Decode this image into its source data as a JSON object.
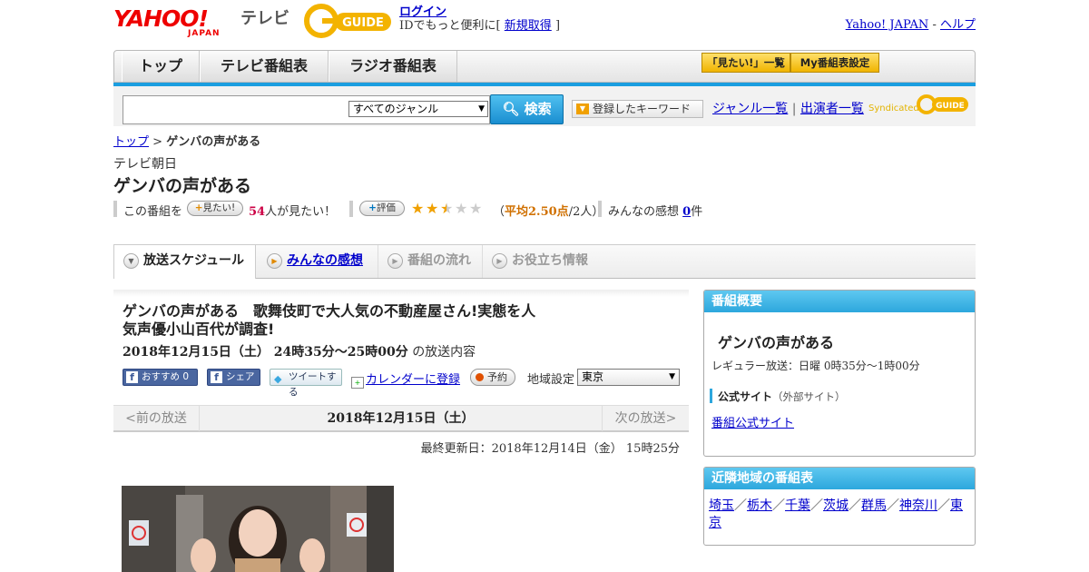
{
  "header": {
    "yahoo_logo": "YAHOO!",
    "yahoo_sub": "JAPAN",
    "tv_label": "テレビ",
    "gguide_logo": "G GUIDE",
    "login_label": "ログイン",
    "id_prefix": "IDでもっと便利に[",
    "signup_label": "新規取得",
    "id_suffix": "]",
    "yahoo_japan_link": "Yahoo! JAPAN",
    "separator": "-",
    "help_link": "ヘルプ"
  },
  "nav": {
    "top": "トップ",
    "tv_guide": "テレビ番組表",
    "radio_guide": "ラジオ番組表",
    "mitai_list": "「見たい!」一覧",
    "my_guide": "My番組表設定"
  },
  "search": {
    "placeholder": "",
    "genre_selected": "すべてのジャンル",
    "search_button": "検索",
    "keyword_button": "登録したキーワード",
    "genre_list_link": "ジャンル一覧",
    "link_separator": "|",
    "performers_link": "出演者一覧",
    "syndicated_label": "Syndicated"
  },
  "breadcrumb": {
    "top": "トップ",
    "sep": ">",
    "current": "ゲンバの声がある"
  },
  "program": {
    "station": "テレビ朝日",
    "title": "ゲンバの声がある",
    "mitai_prefix": "この番組を",
    "mitai_button": "見たい!",
    "mitai_count": "54",
    "mitai_suffix": "人が見たい！",
    "rating_button": "評価",
    "rating_value": 2.5,
    "rating_max": 5,
    "rating_open": "（",
    "rating_avg": "平均2.50点",
    "rating_people": "/2人）",
    "kanso_label": "みんなの感想",
    "kanso_count": "0",
    "kanso_unit": "件"
  },
  "tabs": {
    "schedule": "放送スケジュール",
    "kanso": "みんなの感想",
    "flow": "番組の流れ",
    "info": "お役立ち情報"
  },
  "episode": {
    "title": "ゲンバの声がある　歌舞伎町で大人気の不動産屋さん!実態を人気声優小山百代が調査!",
    "datetime": "2018年12月15日（土）  24時35分～25時00分",
    "date_suffix": "の放送内容",
    "fb_recommend": "おすすめ 0",
    "fb_share": "シェア",
    "tweet": "ツイートする",
    "calendar": "カレンダーに登録",
    "reserve": "予約",
    "region_label": "地域設定",
    "region_selected": "東京",
    "prev": "<前の放送",
    "current_date": "2018年12月15日（土）",
    "next": "次の放送>",
    "updated": "最終更新日：2018年12月14日（金）  15時25分"
  },
  "overview": {
    "header": "番組概要",
    "title": "ゲンバの声がある",
    "regular": "レギュラー放送：日曜 0時35分～1時00分",
    "official_header": "公式サイト",
    "official_sub": "（外部サイト）",
    "official_link": "番組公式サイト"
  },
  "nearby": {
    "header": "近隣地域の番組表",
    "regions": [
      "埼玉",
      "栃木",
      "千葉",
      "茨城",
      "群馬",
      "神奈川",
      "東京"
    ],
    "sep": "／"
  },
  "colors": {
    "accent_blue": "#1b9ee0",
    "link_blue": "#0000cc",
    "yahoo_red": "#ee0000",
    "star_gold": "#f0a000"
  }
}
